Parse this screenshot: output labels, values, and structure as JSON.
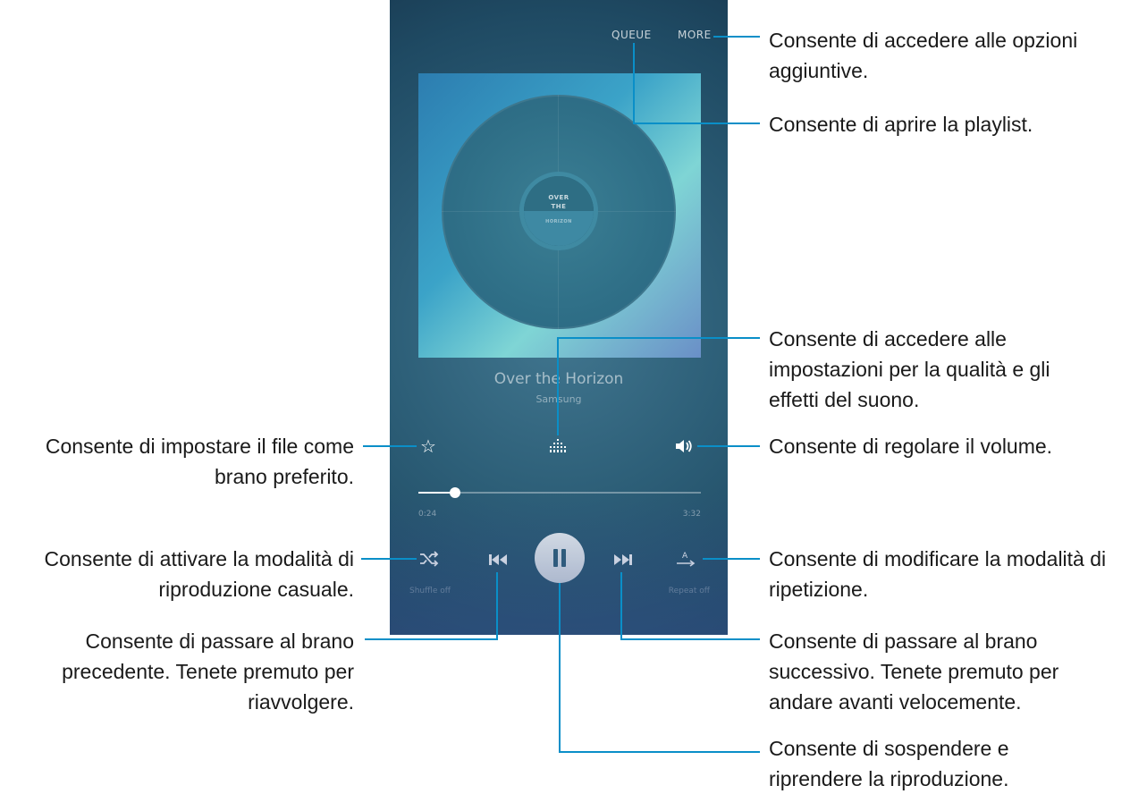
{
  "player": {
    "queue_label": "QUEUE",
    "more_label": "MORE",
    "album_art_text": [
      "OVER",
      "THE",
      "HORIZON"
    ],
    "track_title": "Over the Horizon",
    "track_artist": "Samsung",
    "progress": {
      "current_time": "0:24",
      "total_time": "3:32",
      "fraction": 0.13
    },
    "shuffle_sublabel": "Shuffle off",
    "repeat_sublabel": "Repeat off",
    "icons": {
      "favorite": "star-outline-icon",
      "sound_quality": "equalizer-icon",
      "volume": "speaker-icon",
      "shuffle": "shuffle-icon",
      "previous": "skip-previous-icon",
      "play_pause": "pause-icon",
      "next": "skip-next-icon",
      "repeat": "repeat-a-icon"
    }
  },
  "callouts": {
    "more_options": "Consente di accedere alle opzioni aggiuntive.",
    "playlist": "Consente di aprire la playlist.",
    "sound_settings": "Consente di accedere alle impostazioni per la qualità e gli effetti del suono.",
    "favorite": "Consente di impostare il file come brano preferito.",
    "volume": "Consente di regolare il volume.",
    "shuffle": "Consente di attivare la modalità di riproduzione casuale.",
    "repeat": "Consente di modificare la modalità di ripetizione.",
    "previous": "Consente di passare al brano precedente. Tenete premuto per riavvolgere.",
    "next": "Consente di passare al brano successivo. Tenete premuto per andare avanti velocemente.",
    "pause": "Consente di sospendere e riprendere la riproduzione."
  },
  "colors": {
    "callout_line": "#0a8fc8",
    "screen_bg": "#2d5f78"
  }
}
